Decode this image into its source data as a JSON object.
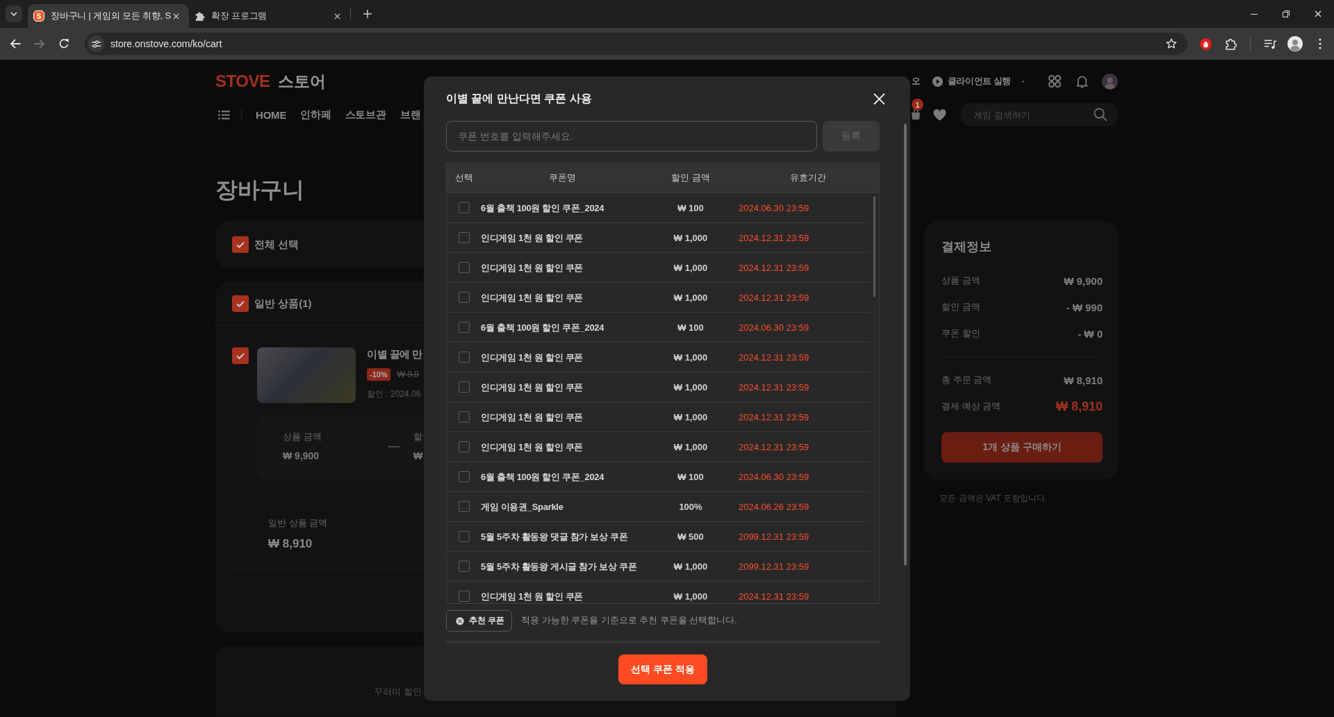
{
  "browser": {
    "tabs": [
      {
        "kind": "site",
        "favicon": "S",
        "title": "장바구니 | 게임의 모든 취향, S",
        "selected": true
      },
      {
        "kind": "extensions",
        "title": "확장 프로그램",
        "selected": false
      }
    ],
    "nav_buttons": [
      {
        "kind": "back",
        "disabled": false
      },
      {
        "kind": "forward",
        "disabled": true
      },
      {
        "kind": "reload",
        "disabled": false
      }
    ],
    "address": "store.onstove.com/ko/cart"
  },
  "header": {
    "logo": {
      "brand": "STOVE",
      "suffix": "스토어"
    },
    "top_links": [
      {
        "kind": "text",
        "label": "오"
      },
      {
        "kind": "launch",
        "label": "클라이언트 실행"
      }
    ],
    "nav": [
      "HOME",
      "인하페",
      "스토브관",
      "브랜"
    ],
    "cart_badge": "1",
    "search": {
      "placeholder": "게임 검색하기"
    }
  },
  "cart": {
    "title": "장바구니",
    "select_all": {
      "label": "전체 선택",
      "checked": true
    },
    "group": {
      "label": "일반 상품(1)",
      "checked": true,
      "item": {
        "checked": true,
        "title": "이별 끝에 만",
        "discount": "-10%",
        "original_price": "₩ 9,9",
        "sale_period": "할인 : 2024.06",
        "price_columns": [
          {
            "label": "상품 금액",
            "value": "₩ 9,900"
          },
          {
            "label": "할",
            "value": "₩"
          }
        ]
      },
      "subtotal": {
        "label": "일반 상품 금액",
        "value": "₩ 8,910"
      }
    },
    "bundle_note": "꾸러미 할인"
  },
  "payment": {
    "title": "결제정보",
    "rows": [
      {
        "label": "상품 금액",
        "value": "₩ 9,900"
      },
      {
        "label": "할인 금액",
        "value": "- ₩ 990"
      },
      {
        "label": "쿠폰 할인",
        "value": "- ₩ 0"
      }
    ],
    "totals": [
      {
        "label": "총 주문 금액",
        "value": "₩ 8,910",
        "highlight": false
      },
      {
        "label": "결제 예상 금액",
        "value": "₩ 8,910",
        "highlight": true
      }
    ],
    "button": "1개 상품 구매하기",
    "note": "· 모든 금액은 VAT 포함입니다."
  },
  "modal": {
    "title": "이별 끝에 만난다면 쿠폰 사용",
    "coupon_input": {
      "placeholder": "쿠폰 번호를 입력해주세요."
    },
    "register_button": {
      "label": "등록",
      "disabled": true
    },
    "table": {
      "columns": [
        "선택",
        "쿠폰명",
        "할인 금액",
        "유효기간"
      ],
      "rows": [
        {
          "checked": false,
          "name": "6월 출책 100원 할인 쿠폰_2024",
          "amount": "₩ 100",
          "expires": "2024.06.30 23:59"
        },
        {
          "checked": false,
          "name": "인디게임 1천 원 할인 쿠폰",
          "amount": "₩ 1,000",
          "expires": "2024.12.31 23:59"
        },
        {
          "checked": false,
          "name": "인디게임 1천 원 할인 쿠폰",
          "amount": "₩ 1,000",
          "expires": "2024.12.31 23:59"
        },
        {
          "checked": false,
          "name": "인디게임 1천 원 할인 쿠폰",
          "amount": "₩ 1,000",
          "expires": "2024.12.31 23:59"
        },
        {
          "checked": false,
          "name": "6월 출책 100원 할인 쿠폰_2024",
          "amount": "₩ 100",
          "expires": "2024.06.30 23:59"
        },
        {
          "checked": false,
          "name": "인디게임 1천 원 할인 쿠폰",
          "amount": "₩ 1,000",
          "expires": "2024.12.31 23:59"
        },
        {
          "checked": false,
          "name": "인디게임 1천 원 할인 쿠폰",
          "amount": "₩ 1,000",
          "expires": "2024.12.31 23:59"
        },
        {
          "checked": false,
          "name": "인디게임 1천 원 할인 쿠폰",
          "amount": "₩ 1,000",
          "expires": "2024.12.31 23:59"
        },
        {
          "checked": false,
          "name": "인디게임 1천 원 할인 쿠폰",
          "amount": "₩ 1,000",
          "expires": "2024.12.31 23:59"
        },
        {
          "checked": false,
          "name": "6월 출책 100원 할인 쿠폰_2024",
          "amount": "₩ 100",
          "expires": "2024.06.30 23:59"
        },
        {
          "checked": false,
          "name": "게임 이용권_Sparkle",
          "amount": "100%",
          "expires": "2024.06.26 23:59"
        },
        {
          "checked": false,
          "name": "5월 5주차 활동왕 댓글 참가 보상 쿠폰",
          "amount": "₩ 500",
          "expires": "2099.12.31 23:59"
        },
        {
          "checked": false,
          "name": "5월 5주차 활동왕 게시글 참가 보상 쿠폰",
          "amount": "₩ 1,000",
          "expires": "2099.12.31 23:59"
        },
        {
          "checked": false,
          "name": "인디게임 1천 원 할인 쿠폰",
          "amount": "₩ 1,000",
          "expires": "2024.12.31 23:59"
        }
      ]
    },
    "recommend_button": "추천 쿠폰",
    "recommend_note": "적용 가능한 쿠폰을 기준으로 추천 쿠폰을 선택합니다.",
    "apply_button": "선택 쿠폰 적용"
  }
}
